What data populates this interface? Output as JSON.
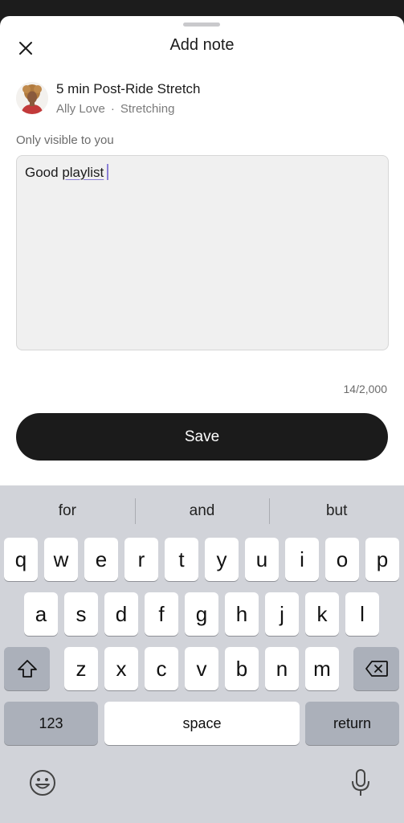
{
  "sheet": {
    "title": "Add note",
    "close_icon": "close-icon"
  },
  "class_info": {
    "title": "5 min Post-Ride Stretch",
    "instructor": "Ally Love",
    "separator": "·",
    "category": "Stretching"
  },
  "note": {
    "visibility_label": "Only visible to you",
    "text_plain": "Good ",
    "text_underlined": "playlist",
    "char_count": "14/2,000"
  },
  "actions": {
    "save_label": "Save"
  },
  "keyboard": {
    "suggestions": [
      "for",
      "and",
      "but"
    ],
    "row1": [
      "q",
      "w",
      "e",
      "r",
      "t",
      "y",
      "u",
      "i",
      "o",
      "p"
    ],
    "row2": [
      "a",
      "s",
      "d",
      "f",
      "g",
      "h",
      "j",
      "k",
      "l"
    ],
    "row3": [
      "z",
      "x",
      "c",
      "v",
      "b",
      "n",
      "m"
    ],
    "numbers_label": "123",
    "space_label": "space",
    "return_label": "return",
    "shift_icon": "shift-icon",
    "backspace_icon": "backspace-icon",
    "emoji_icon": "emoji-icon",
    "mic_icon": "microphone-icon"
  },
  "colors": {
    "button_bg": "#1b1b1b",
    "caret": "#8a7fd6",
    "keyboard_bg": "#d1d3d9"
  }
}
